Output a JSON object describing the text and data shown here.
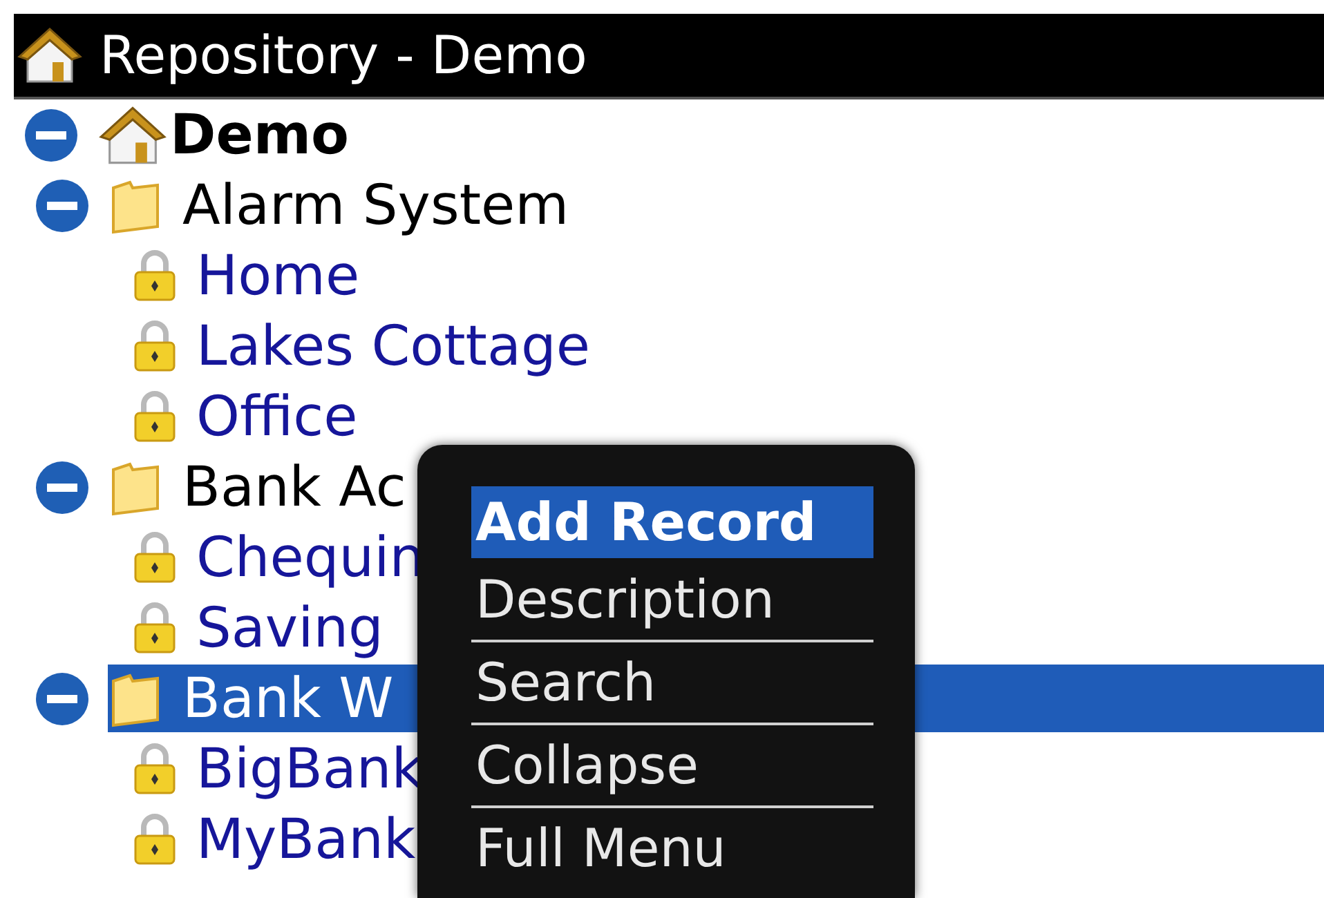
{
  "window": {
    "title": "Repository - Demo"
  },
  "tree": [
    {
      "kind": "root",
      "label": "Demo",
      "expanded": true,
      "selected": false,
      "children": [
        {
          "kind": "folder",
          "label": "Alarm System",
          "expanded": true,
          "selected": false,
          "children": [
            {
              "kind": "record",
              "label": "Home",
              "selected": false
            },
            {
              "kind": "record",
              "label": "Lakes Cottage",
              "selected": false
            },
            {
              "kind": "record",
              "label": "Office",
              "selected": false
            }
          ]
        },
        {
          "kind": "folder",
          "label": "Bank Ac",
          "expanded": true,
          "selected": false,
          "children": [
            {
              "kind": "record",
              "label": "Chequin",
              "selected": false
            },
            {
              "kind": "record",
              "label": "Saving",
              "selected": false
            }
          ]
        },
        {
          "kind": "folder",
          "label": "Bank W",
          "expanded": true,
          "selected": true,
          "children": [
            {
              "kind": "record",
              "label": "BigBank",
              "selected": false
            },
            {
              "kind": "record",
              "label": "MyBank",
              "selected": false
            }
          ]
        }
      ]
    }
  ],
  "context_menu": {
    "items": [
      {
        "label": "Add Record",
        "selected": true,
        "divider_after": false
      },
      {
        "label": "Description",
        "selected": false,
        "divider_after": true
      },
      {
        "label": "Search",
        "selected": false,
        "divider_after": true
      },
      {
        "label": "Collapse",
        "selected": false,
        "divider_after": true
      },
      {
        "label": "Full Menu",
        "selected": false,
        "divider_after": false
      }
    ]
  }
}
